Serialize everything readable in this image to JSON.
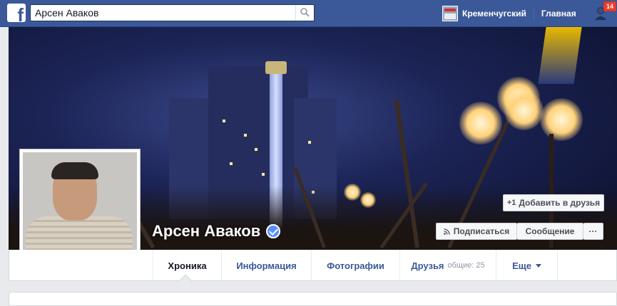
{
  "topbar": {
    "logo_letter": "f",
    "search_value": "Арсен Аваков",
    "profile_link": "Кременчугский",
    "home_link": "Главная",
    "friend_requests_count": "14"
  },
  "profile": {
    "name": "Арсен Аваков",
    "verified": true,
    "add_friend_label": "Добавить в друзья",
    "add_friend_icon": "+1",
    "subscribe_label": "Подписаться",
    "subscribe_icon": "rss-icon",
    "message_label": "Сообщение",
    "more_label": "···"
  },
  "tabs": [
    {
      "label": "Хроника",
      "active": true
    },
    {
      "label": "Информация"
    },
    {
      "label": "Фотографии"
    },
    {
      "label": "Друзья",
      "count": "общие: 25"
    },
    {
      "label": "Еще",
      "dropdown": true
    }
  ],
  "colors": {
    "brand": "#3b5998",
    "verified": "#5890ff",
    "badge": "#f03d25"
  }
}
